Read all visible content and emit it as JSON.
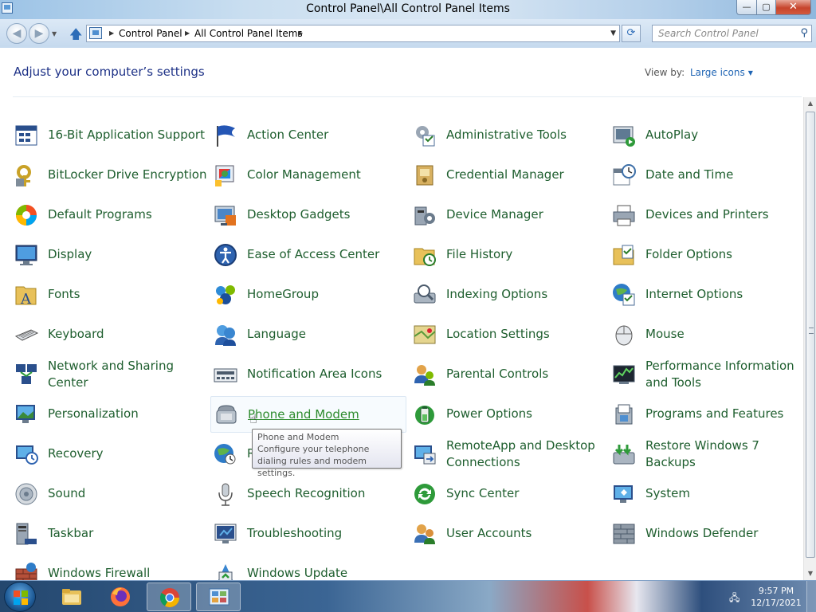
{
  "window": {
    "title": "Control Panel\\All Control Panel Items",
    "controls": {
      "minimize": "—",
      "maximize": "▢",
      "close": "✕"
    }
  },
  "navbar": {
    "breadcrumbs": [
      "Control Panel",
      "All Control Panel Items"
    ],
    "search_placeholder": "Search Control Panel"
  },
  "content": {
    "heading": "Adjust your computer’s settings",
    "view_by_label": "View by:",
    "view_by_value": "Large icons"
  },
  "items": [
    {
      "label": "16-Bit Application Support",
      "icon": "app-support-icon"
    },
    {
      "label": "Action Center",
      "icon": "flag-icon"
    },
    {
      "label": "Administrative Tools",
      "icon": "admin-tools-icon"
    },
    {
      "label": "AutoPlay",
      "icon": "autoplay-icon"
    },
    {
      "label": "BitLocker Drive Encryption",
      "icon": "bitlocker-icon"
    },
    {
      "label": "Color Management",
      "icon": "color-management-icon"
    },
    {
      "label": "Credential Manager",
      "icon": "credential-icon"
    },
    {
      "label": "Date and Time",
      "icon": "calendar-clock-icon"
    },
    {
      "label": "Default Programs",
      "icon": "default-programs-icon"
    },
    {
      "label": "Desktop Gadgets",
      "icon": "gadgets-icon"
    },
    {
      "label": "Device Manager",
      "icon": "device-manager-icon"
    },
    {
      "label": "Devices and Printers",
      "icon": "printer-icon"
    },
    {
      "label": "Display",
      "icon": "monitor-icon"
    },
    {
      "label": "Ease of Access Center",
      "icon": "ease-of-access-icon"
    },
    {
      "label": "File History",
      "icon": "file-history-icon"
    },
    {
      "label": "Folder Options",
      "icon": "folder-options-icon"
    },
    {
      "label": "Fonts",
      "icon": "fonts-icon"
    },
    {
      "label": "HomeGroup",
      "icon": "homegroup-icon"
    },
    {
      "label": "Indexing Options",
      "icon": "indexing-icon"
    },
    {
      "label": "Internet Options",
      "icon": "internet-options-icon"
    },
    {
      "label": "Keyboard",
      "icon": "keyboard-icon"
    },
    {
      "label": "Language",
      "icon": "language-icon"
    },
    {
      "label": "Location Settings",
      "icon": "location-icon"
    },
    {
      "label": "Mouse",
      "icon": "mouse-icon"
    },
    {
      "label": "Network and Sharing Center",
      "icon": "network-icon"
    },
    {
      "label": "Notification Area Icons",
      "icon": "notification-icon"
    },
    {
      "label": "Parental Controls",
      "icon": "parental-controls-icon"
    },
    {
      "label": "Performance Information and Tools",
      "icon": "performance-icon"
    },
    {
      "label": "Personalization",
      "icon": "personalization-icon"
    },
    {
      "label": "Phone and Modem",
      "icon": "phone-modem-icon"
    },
    {
      "label": "Power Options",
      "icon": "battery-icon"
    },
    {
      "label": "Programs and Features",
      "icon": "programs-icon"
    },
    {
      "label": "Recovery",
      "icon": "recovery-icon"
    },
    {
      "label": "R",
      "icon": "region-icon"
    },
    {
      "label": "RemoteApp and Desktop Connections",
      "icon": "remoteapp-icon"
    },
    {
      "label": "Restore Windows 7 Backups",
      "icon": "restore-icon"
    },
    {
      "label": "Sound",
      "icon": "speaker-icon"
    },
    {
      "label": "Speech Recognition",
      "icon": "microphone-icon"
    },
    {
      "label": "Sync Center",
      "icon": "sync-icon"
    },
    {
      "label": "System",
      "icon": "system-icon"
    },
    {
      "label": "Taskbar",
      "icon": "taskbar-icon"
    },
    {
      "label": "Troubleshooting",
      "icon": "troubleshooting-icon"
    },
    {
      "label": "User Accounts",
      "icon": "user-accounts-icon"
    },
    {
      "label": "Windows Defender",
      "icon": "defender-icon"
    },
    {
      "label": "Windows Firewall",
      "icon": "firewall-icon"
    },
    {
      "label": "Windows Update",
      "icon": "windows-update-icon"
    }
  ],
  "tooltip": {
    "title": "Phone and Modem",
    "description": "Configure your telephone dialing rules and modem settings."
  },
  "taskbar": {
    "pinned": [
      "file-explorer-icon",
      "firefox-icon",
      "chrome-icon",
      "control-panel-icon"
    ],
    "time": "9:57 PM",
    "date": "12/17/2021"
  },
  "colors": {
    "link_green": "#1e5e2e",
    "heading_blue": "#1e3287",
    "accent_blue": "#1e64b4"
  }
}
